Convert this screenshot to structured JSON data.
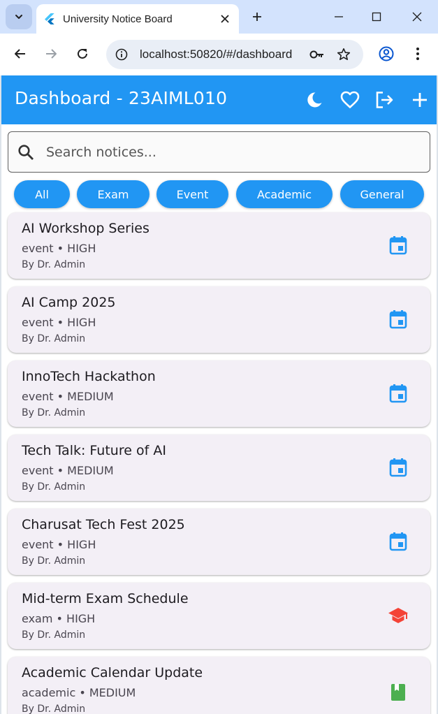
{
  "browser": {
    "tab_title": "University Notice Board",
    "url": "localhost:50820/#/dashboard",
    "accent": "#d3e3fd"
  },
  "appbar": {
    "title": "Dashboard - 23AIML010",
    "color": "#2196f3",
    "actions": [
      "dark-mode-icon",
      "favorite-icon",
      "logout-icon",
      "add-icon"
    ]
  },
  "search": {
    "placeholder": "Search notices...",
    "value": ""
  },
  "filters": [
    "All",
    "Exam",
    "Event",
    "Academic",
    "General"
  ],
  "notices": [
    {
      "title": "AI Workshop Series",
      "meta": "event • HIGH",
      "author": "By Dr. Admin",
      "icon": "event-icon",
      "icon_color": "#2196f3"
    },
    {
      "title": "AI Camp 2025",
      "meta": "event • HIGH",
      "author": "By Dr. Admin",
      "icon": "event-icon",
      "icon_color": "#2196f3"
    },
    {
      "title": "InnoTech Hackathon",
      "meta": "event • MEDIUM",
      "author": "By Dr. Admin",
      "icon": "event-icon",
      "icon_color": "#2196f3"
    },
    {
      "title": "Tech Talk: Future of AI",
      "meta": "event • MEDIUM",
      "author": "By Dr. Admin",
      "icon": "event-icon",
      "icon_color": "#2196f3"
    },
    {
      "title": "Charusat Tech Fest 2025",
      "meta": "event • HIGH",
      "author": "By Dr. Admin",
      "icon": "event-icon",
      "icon_color": "#2196f3"
    },
    {
      "title": "Mid-term Exam Schedule",
      "meta": "exam • HIGH",
      "author": "By Dr. Admin",
      "icon": "school-icon",
      "icon_color": "#f44336"
    },
    {
      "title": "Academic Calendar Update",
      "meta": "academic • MEDIUM",
      "author": "By Dr. Admin",
      "icon": "book-icon",
      "icon_color": "#4caf50"
    }
  ]
}
